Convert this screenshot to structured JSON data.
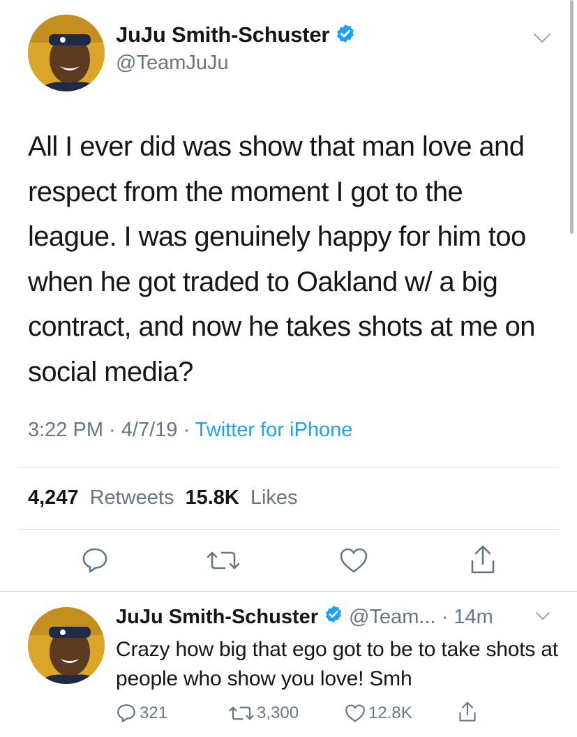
{
  "tweet": {
    "author_name": "JuJu Smith-Schuster",
    "author_handle": "@TeamJuJu",
    "text": "All I ever did was show that man love and respect from the moment I got to the league. I was genuinely happy for him too when he got traded to Oakland w/ a big contract, and now he takes shots at me on social media?",
    "time": "3:22 PM",
    "date": "4/7/19",
    "separator": " · ",
    "source": "Twitter for iPhone",
    "retweets_count": "4,247",
    "retweets_label": "Retweets",
    "likes_count": "15.8K",
    "likes_label": "Likes"
  },
  "reply": {
    "author_name": "JuJu Smith-Schuster",
    "author_handle": "@Team... · 14m",
    "text": "Crazy how big that ego got to be to take shots at people who show you love! Smh",
    "reply_count": "321",
    "retweet_count": "3,300",
    "like_count": "12.8K"
  },
  "icons": {
    "verified": "verified-badge-icon",
    "caret": "chevron-down-icon",
    "reply": "reply-icon",
    "retweet": "retweet-icon",
    "like": "heart-icon",
    "share": "share-icon"
  },
  "colors": {
    "accent": "#1da1f2",
    "secondary_text": "#657786",
    "primary_text": "#14171a",
    "divider": "#dfe3e6"
  }
}
